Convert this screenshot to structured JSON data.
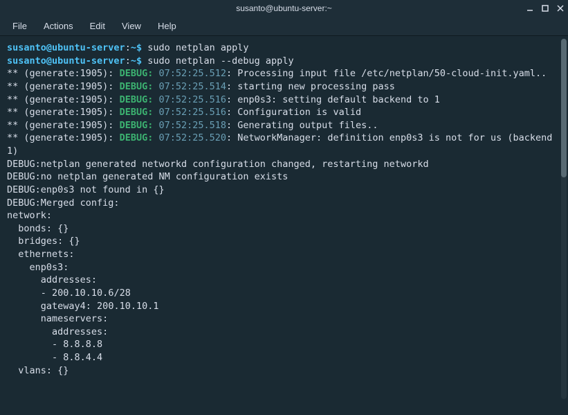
{
  "window": {
    "title": "susanto@ubuntu-server:~"
  },
  "menubar": {
    "items": [
      "File",
      "Actions",
      "Edit",
      "View",
      "Help"
    ]
  },
  "prompt": {
    "user_host": "susanto@ubuntu-server",
    "sep": ":",
    "path": "~",
    "symbol": "$"
  },
  "commands": [
    "sudo netplan apply",
    "sudo netplan --debug apply"
  ],
  "debug_lines": [
    {
      "prefix": "** (generate:1905): ",
      "kw": "DEBUG:",
      "ts": " 07:52:25.512",
      "msg": ": Processing input file /etc/netplan/50-cloud-init.yaml.."
    },
    {
      "prefix": "** (generate:1905): ",
      "kw": "DEBUG:",
      "ts": " 07:52:25.514",
      "msg": ": starting new processing pass"
    },
    {
      "prefix": "** (generate:1905): ",
      "kw": "DEBUG:",
      "ts": " 07:52:25.516",
      "msg": ": enp0s3: setting default backend to 1"
    },
    {
      "prefix": "** (generate:1905): ",
      "kw": "DEBUG:",
      "ts": " 07:52:25.516",
      "msg": ": Configuration is valid"
    },
    {
      "prefix": "** (generate:1905): ",
      "kw": "DEBUG:",
      "ts": " 07:52:25.518",
      "msg": ": Generating output files.."
    },
    {
      "prefix": "** (generate:1905): ",
      "kw": "DEBUG:",
      "ts": " 07:52:25.520",
      "msg": ": NetworkManager: definition enp0s3 is not for us (backend 1)"
    }
  ],
  "plain_lines": [
    "DEBUG:netplan generated networkd configuration changed, restarting networkd",
    "DEBUG:no netplan generated NM configuration exists",
    "DEBUG:enp0s3 not found in {}",
    "DEBUG:Merged config:",
    "network:",
    "  bonds: {}",
    "  bridges: {}",
    "  ethernets:",
    "    enp0s3:",
    "      addresses:",
    "      - 200.10.10.6/28",
    "      gateway4: 200.10.10.1",
    "      nameservers:",
    "        addresses:",
    "        - 8.8.8.8",
    "        - 8.8.4.4",
    "  vlans: {}"
  ]
}
